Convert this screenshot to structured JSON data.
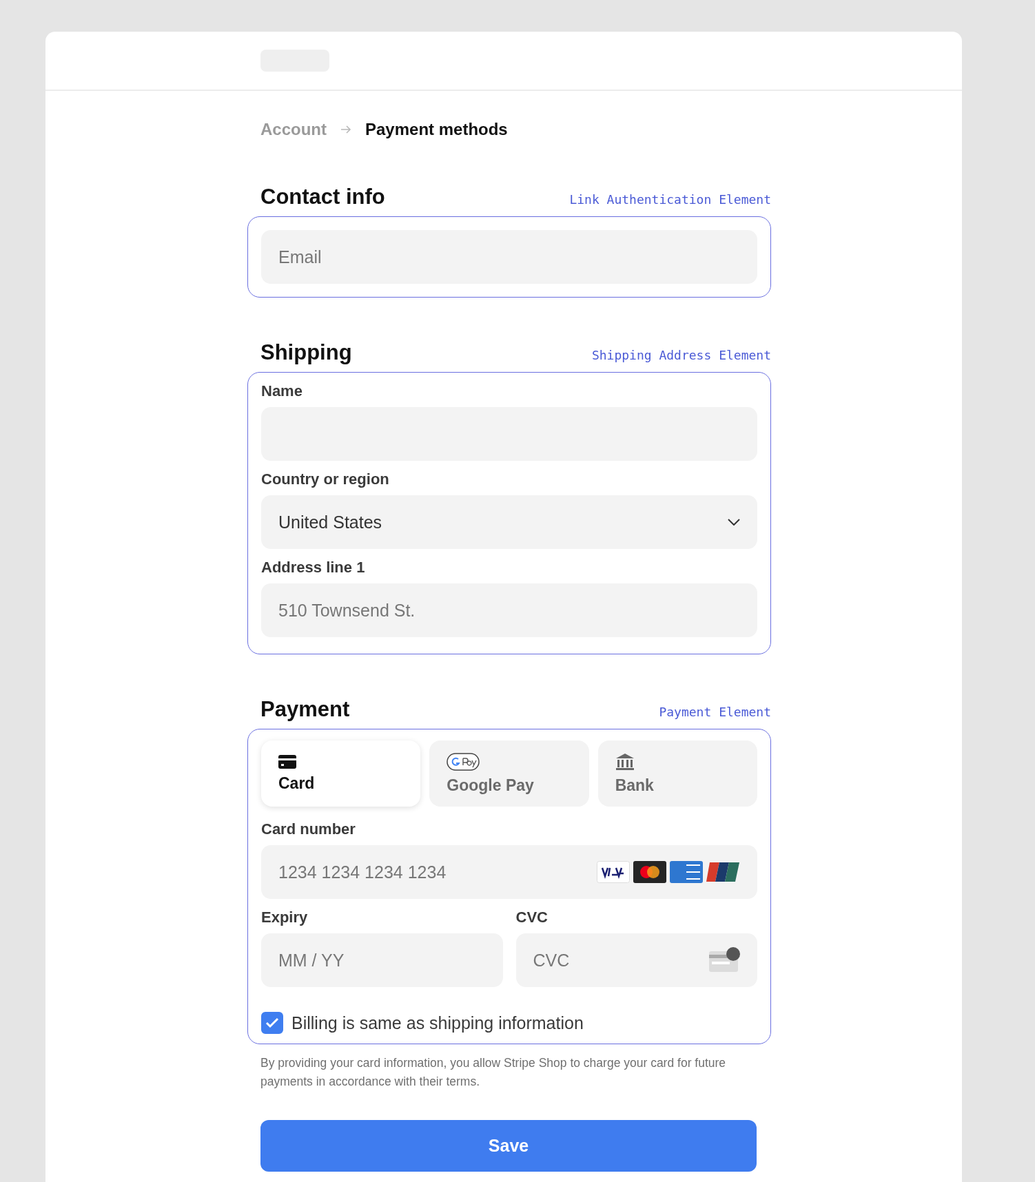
{
  "breadcrumb": [
    {
      "label": "Account",
      "current": false
    },
    {
      "label": "Payment methods",
      "current": true
    }
  ],
  "contact": {
    "title": "Contact info",
    "element_label": "Link Authentication Element",
    "email": {
      "placeholder": "Email"
    }
  },
  "shipping": {
    "title": "Shipping",
    "element_label": "Shipping Address Element",
    "fields": [
      {
        "kind": "input",
        "label": "Name"
      },
      {
        "kind": "select",
        "label": "Country or region",
        "value": "United States"
      },
      {
        "kind": "input",
        "label": "Address line 1",
        "placeholder": "510 Townsend St."
      }
    ]
  },
  "payment": {
    "title": "Payment",
    "element_label": "Payment Element",
    "methods": [
      {
        "kind": "card",
        "label": "Card",
        "selected": true
      },
      {
        "kind": "gpay",
        "label": "Google Pay",
        "selected": false
      },
      {
        "kind": "bank",
        "label": "Bank",
        "selected": false
      }
    ],
    "card_number": {
      "label": "Card number",
      "placeholder": "1234 1234 1234 1234"
    },
    "expiry": {
      "label": "Expiry",
      "placeholder": "MM / YY"
    },
    "cvc": {
      "label": "CVC",
      "placeholder": "CVC"
    },
    "billing_same": {
      "label": "Billing is same as shipping information",
      "checked": true
    }
  },
  "legal": "By providing your card information, you allow Stripe Shop to charge your card for future payments in accordance with their terms.",
  "save_button": "Save"
}
